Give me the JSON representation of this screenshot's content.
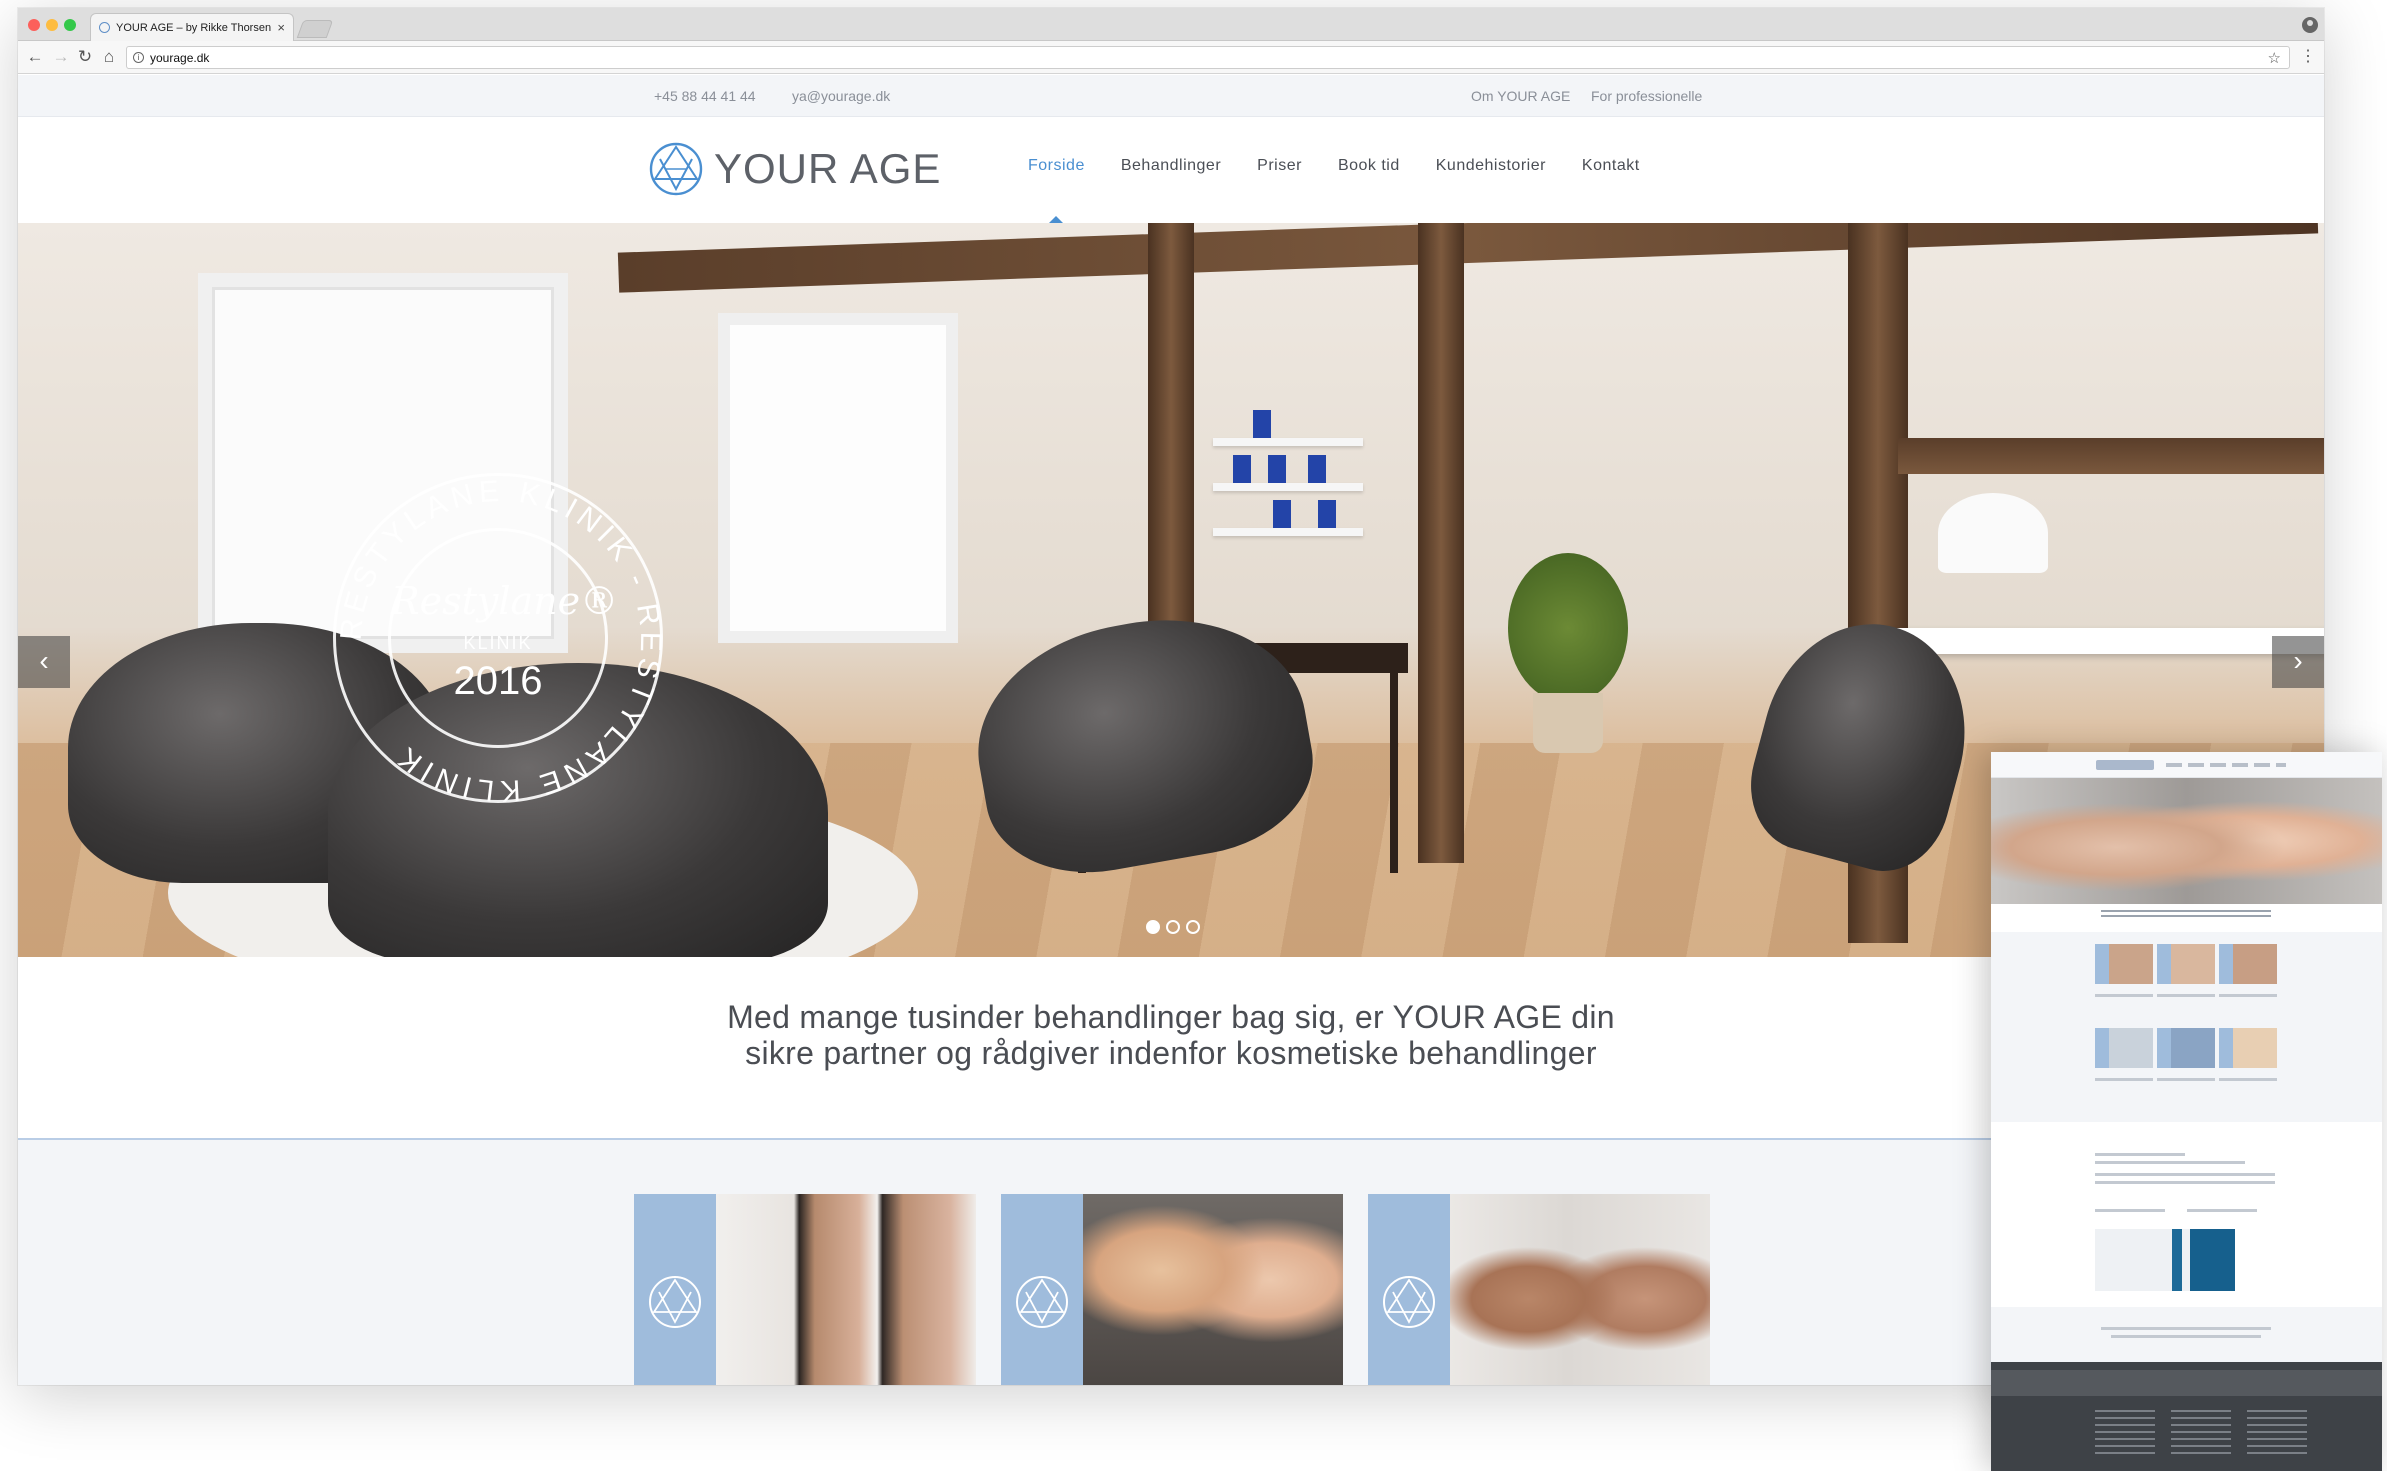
{
  "browser": {
    "tab_title": "YOUR AGE – by Rikke Thorsen",
    "tab_close": "×",
    "url": "yourage.dk",
    "nav_icons": [
      "back-icon",
      "forward-icon",
      "reload-icon",
      "home-icon"
    ],
    "bookmark_icon": "star-icon",
    "menu_icon": "kebab-menu-icon"
  },
  "topbar": {
    "phone": "+45 88 44 41 44",
    "email": "ya@yourage.dk",
    "links": [
      "Om YOUR AGE",
      "For professionelle"
    ]
  },
  "header": {
    "logo_text": "YOUR AGE",
    "nav": [
      "Forside",
      "Behandlinger",
      "Priser",
      "Book tid",
      "Kundehistorier",
      "Kontakt"
    ],
    "active_nav": "Forside",
    "accent_color": "#4a8fd1"
  },
  "hero": {
    "badge": {
      "ring_text": "RESTYLANE KLINIK - RESTYLANE KLINIK",
      "brand": "Restylane®",
      "subtitle": "KLINIK",
      "year": "2016"
    },
    "prev_arrow": "‹",
    "next_arrow": "›",
    "slide_count": 3,
    "active_slide": 1
  },
  "tagline": {
    "line1": "Med mange tusinder behandlinger bag sig, er YOUR AGE din",
    "line2": "sikre partner og rådgiver indenfor kosmetiske behandlinger"
  },
  "cards": {
    "count": 3,
    "strip_color": "#9fbcdc"
  },
  "colors": {
    "topbar_bg": "#f3f5f8",
    "text": "#4a4d53",
    "divider": "#b9cde6"
  }
}
